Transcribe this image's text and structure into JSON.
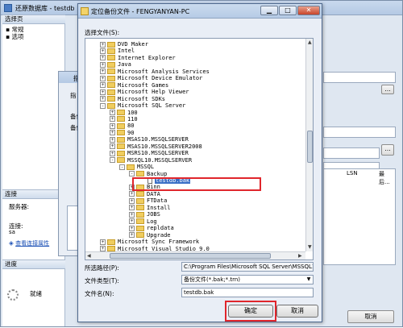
{
  "background_window": {
    "title": "还原数据库 - testdb",
    "select_page_label": "选择页",
    "pages": [
      "常规",
      "选项"
    ],
    "connection_label": "连接",
    "server_label": "服务器:",
    "connect_label": "连接:",
    "connect_value": "sa",
    "view_conn_link": "查看连接属性",
    "progress_label": "进度",
    "status": "就绪",
    "lsn_header": "LSN",
    "last_header": "最后...",
    "cancel_button": "取消"
  },
  "middle_dialog": {
    "title": "指",
    "label1": "指",
    "label2": "备份",
    "label3": "备份"
  },
  "file_dialog": {
    "title": "定位备份文件 - FENGYANYAN-PC",
    "select_file_label": "选择文件(S):",
    "tree": [
      {
        "label": "DVD Maker",
        "level": 0,
        "expander": "+"
      },
      {
        "label": "Intel",
        "level": 0,
        "expander": "+"
      },
      {
        "label": "Internet Explorer",
        "level": 0,
        "expander": "+"
      },
      {
        "label": "Java",
        "level": 0,
        "expander": "+"
      },
      {
        "label": "Microsoft Analysis Services",
        "level": 0,
        "expander": "+"
      },
      {
        "label": "Microsoft Device Emulator",
        "level": 0,
        "expander": "+"
      },
      {
        "label": "Microsoft Games",
        "level": 0,
        "expander": "+"
      },
      {
        "label": "Microsoft Help Viewer",
        "level": 0,
        "expander": "+"
      },
      {
        "label": "Microsoft SDKs",
        "level": 0,
        "expander": "+"
      },
      {
        "label": "Microsoft SQL Server",
        "level": 0,
        "expander": "-"
      },
      {
        "label": "100",
        "level": 1,
        "expander": "+"
      },
      {
        "label": "110",
        "level": 1,
        "expander": "+"
      },
      {
        "label": "80",
        "level": 1,
        "expander": "+"
      },
      {
        "label": "90",
        "level": 1,
        "expander": "+"
      },
      {
        "label": "MSAS10.MSSQLSERVER",
        "level": 1,
        "expander": "+"
      },
      {
        "label": "MSAS10.MSSQLSERVER2008",
        "level": 1,
        "expander": "+"
      },
      {
        "label": "MSRS10.MSSQLSERVER",
        "level": 1,
        "expander": "+"
      },
      {
        "label": "MSSQL10.MSSQLSERVER",
        "level": 1,
        "expander": "-"
      },
      {
        "label": "MSSQL",
        "level": 2,
        "expander": "-"
      },
      {
        "label": "Backup",
        "level": 3,
        "expander": "-"
      },
      {
        "label": "testdb.bak",
        "level": 4,
        "expander": "",
        "file": true,
        "selected": true
      },
      {
        "label": "Binn",
        "level": 3,
        "expander": "+"
      },
      {
        "label": "DATA",
        "level": 3,
        "expander": "+"
      },
      {
        "label": "FTData",
        "level": 3,
        "expander": "+"
      },
      {
        "label": "Install",
        "level": 3,
        "expander": "+"
      },
      {
        "label": "JOBS",
        "level": 3,
        "expander": "+"
      },
      {
        "label": "Log",
        "level": 3,
        "expander": "+"
      },
      {
        "label": "repldata",
        "level": 3,
        "expander": "+"
      },
      {
        "label": "Upgrade",
        "level": 3,
        "expander": "+"
      },
      {
        "label": "Microsoft Sync Framework",
        "level": 0,
        "expander": "+"
      },
      {
        "label": "Microsoft Visual Studio 9.0",
        "level": 0,
        "expander": "+"
      }
    ],
    "path_label": "所选路径(P):",
    "path_value": "C:\\Program Files\\Microsoft SQL Server\\MSSQL10.MSS",
    "type_label": "文件类型(T):",
    "type_value": "备份文件(*.bak;*.trn)",
    "name_label": "文件名(N):",
    "name_value": "testdb.bak",
    "ok_button": "确定",
    "cancel_button": "取消"
  },
  "colors": {
    "highlight": "#e0262c",
    "selection": "#3a6fc6"
  }
}
